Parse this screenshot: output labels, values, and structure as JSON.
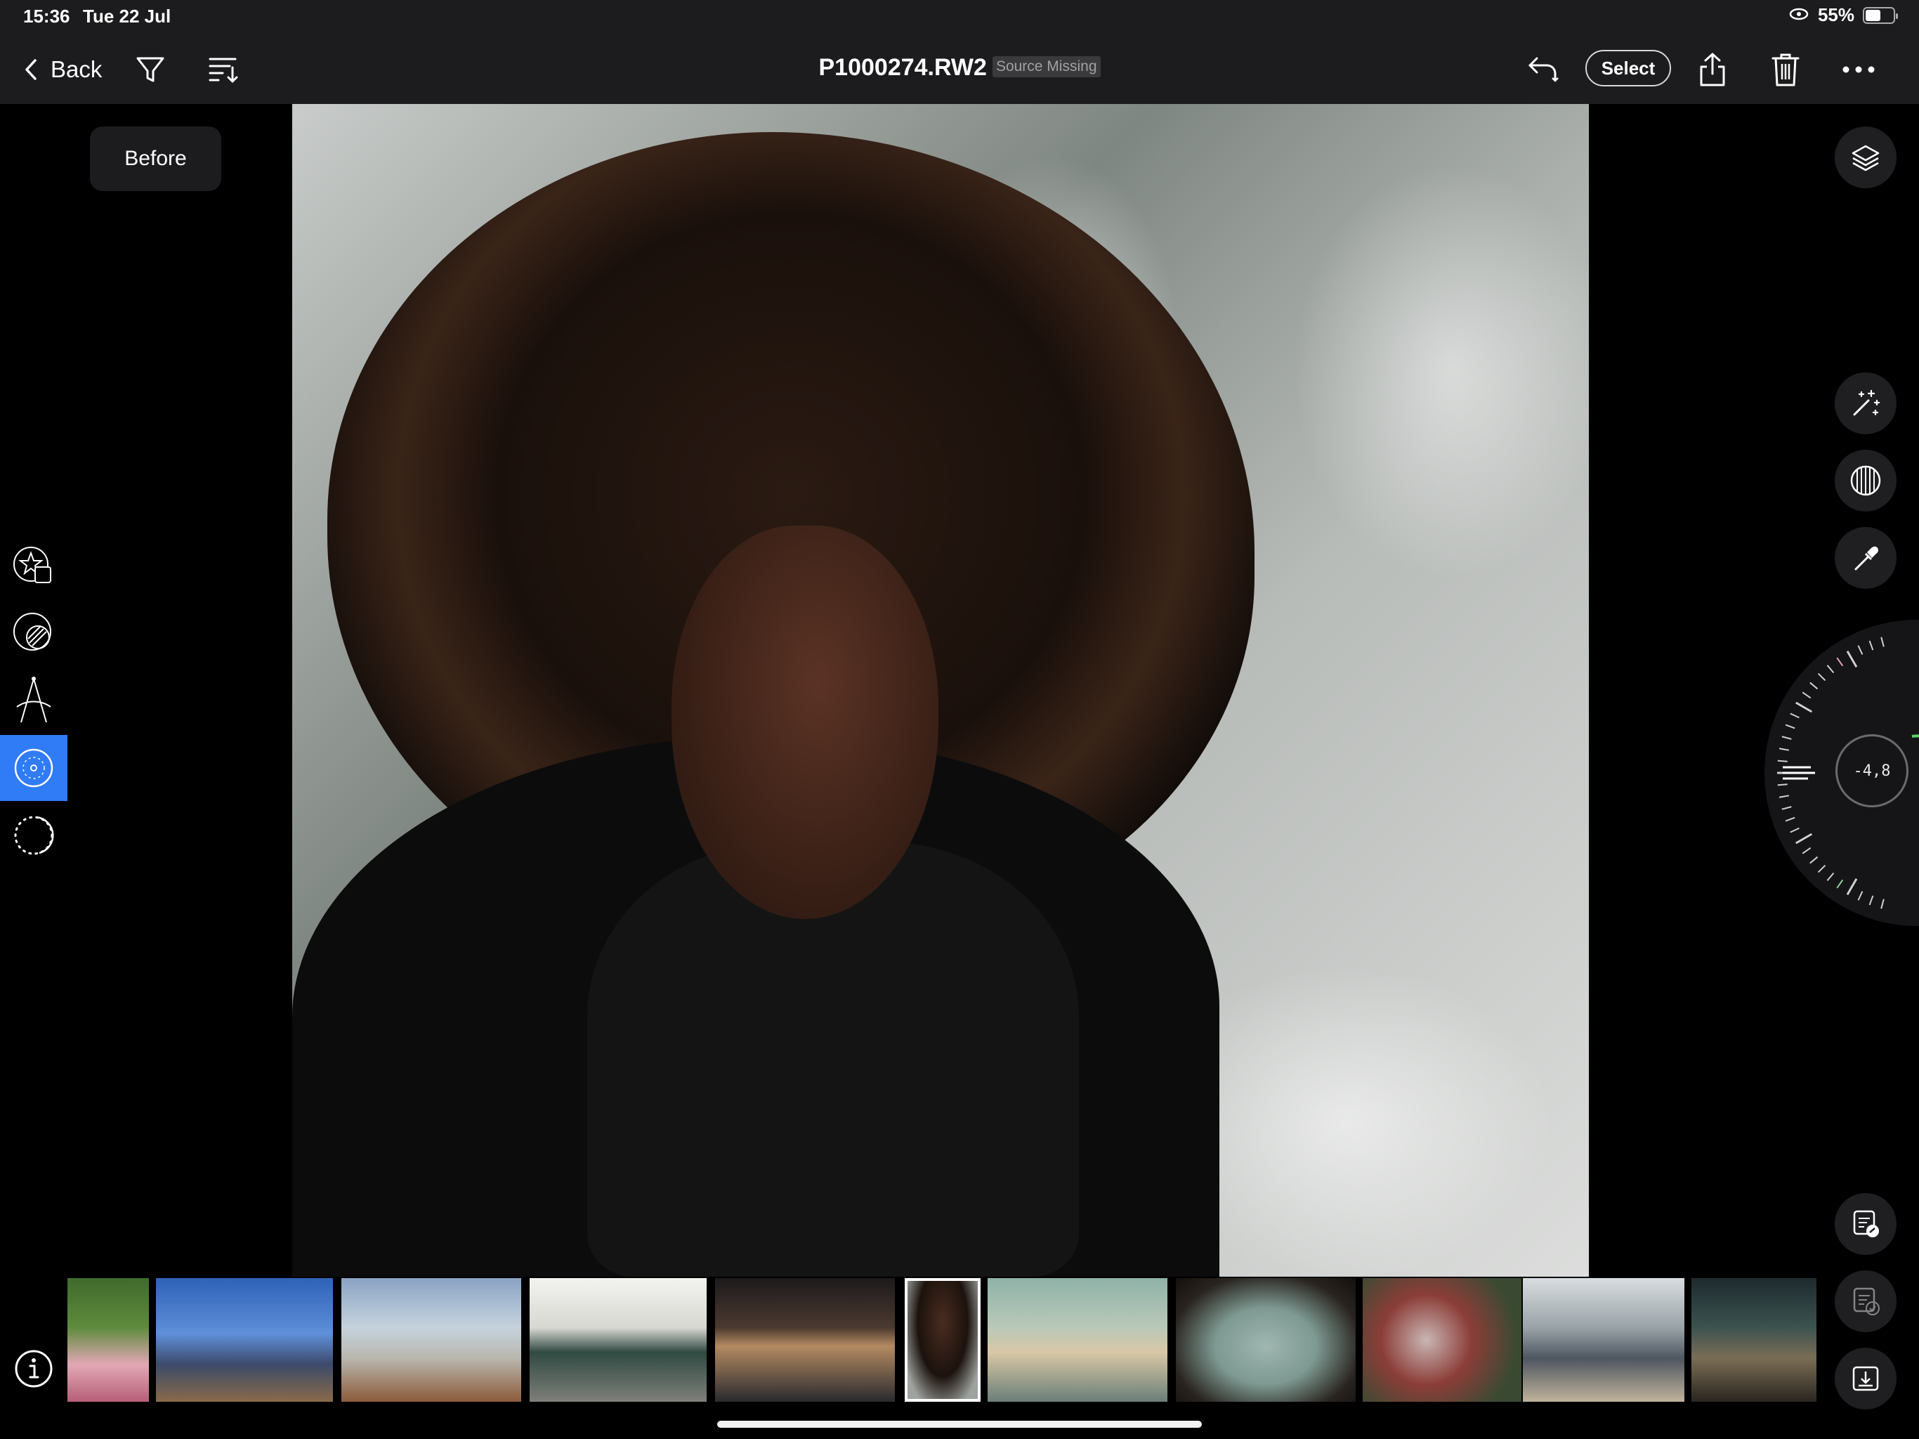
{
  "status_bar": {
    "time": "15:36",
    "date": "Tue 22 Jul",
    "battery": "55%",
    "battery_level": 0.55
  },
  "nav": {
    "back_label": "Back",
    "filter_icon": "filter-icon",
    "sort_icon": "sort-icon",
    "title": "P1000274.RW2",
    "source_badge": "Source Missing",
    "undo_icon": "undo-icon",
    "select_label": "Select",
    "share_icon": "share-icon",
    "trash_icon": "trash-icon",
    "more_icon": "more-icon"
  },
  "before_label": "Before",
  "left_tools": [
    {
      "name": "presets-tool",
      "icon": "star-square-icon",
      "active": false
    },
    {
      "name": "color-tool",
      "icon": "palette-circle-icon",
      "active": false
    },
    {
      "name": "geometry-tool",
      "icon": "perspective-icon",
      "active": false
    },
    {
      "name": "lens-tool",
      "icon": "lens-circle-icon",
      "active": true
    },
    {
      "name": "mask-tool",
      "icon": "dotted-circle-icon",
      "active": false
    }
  ],
  "right_tools": {
    "layers_icon": "layers-icon",
    "magic_icon": "magic-wand-icon",
    "mask_icon": "grid-sphere-icon",
    "picker_icon": "eyedropper-icon",
    "copy_settings_icon": "copy-settings-icon",
    "paste_settings_icon": "paste-settings-icon",
    "export_icon": "export-icon"
  },
  "dial": {
    "value": "-4,8"
  },
  "filmstrip": [
    {
      "name": "thumb-flowers",
      "selected": false
    },
    {
      "name": "thumb-cityscape",
      "selected": false
    },
    {
      "name": "thumb-fountain",
      "selected": false
    },
    {
      "name": "thumb-mini-car",
      "selected": false
    },
    {
      "name": "thumb-night-street",
      "selected": false
    },
    {
      "name": "thumb-portrait",
      "selected": true
    },
    {
      "name": "thumb-beach-woman",
      "selected": false
    },
    {
      "name": "thumb-window-beach",
      "selected": false
    },
    {
      "name": "thumb-leaves",
      "selected": false
    },
    {
      "name": "thumb-airplane",
      "selected": false
    },
    {
      "name": "thumb-cockpit",
      "selected": false
    }
  ],
  "colors": {
    "accent": "#2f7cf6",
    "bar_bg": "#1c1c1e",
    "button_bg": "#1f1f21"
  }
}
